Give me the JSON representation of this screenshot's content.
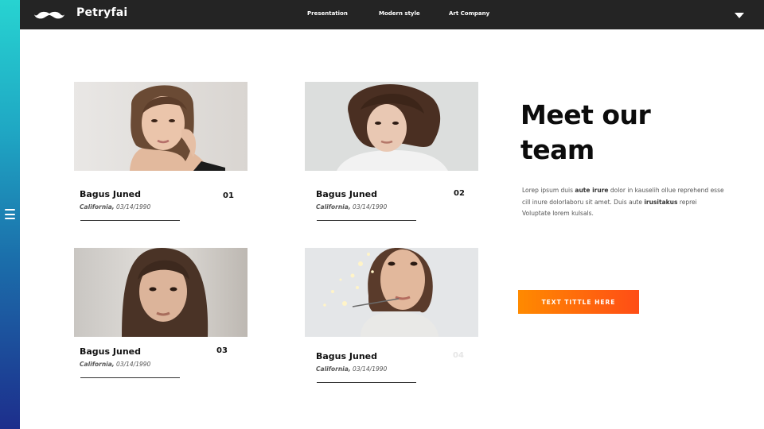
{
  "header": {
    "brand": "Petryfai",
    "logo_icon": "mustache-icon",
    "nav": [
      {
        "label": "Presentation"
      },
      {
        "label": "Modern style"
      },
      {
        "label": "Art Company"
      }
    ],
    "dropdown_icon": "caret-down-icon"
  },
  "sidebar": {
    "menu_icon": "hamburger-menu-icon",
    "gradient": [
      "#27d3d1",
      "#1d2e8c"
    ]
  },
  "team": {
    "cards": [
      {
        "name": "Bagus Juned",
        "location": "California,",
        "date": "03/14/1990",
        "number": "01"
      },
      {
        "name": "Bagus Juned",
        "location": "California,",
        "date": "03/14/1990",
        "number": "02"
      },
      {
        "name": "Bagus Juned",
        "location": "California,",
        "date": "03/14/1990",
        "number": "03"
      },
      {
        "name": "Bagus Juned",
        "location": "California,",
        "date": "03/14/1990",
        "number": "04"
      }
    ]
  },
  "intro": {
    "headline_line1": "Meet our",
    "headline_line2": "team",
    "paragraph": {
      "p1": "Lorep  ipsum duis ",
      "b1": "aute irure",
      "p2": " dolor in kauselih ollue reprehend esse cill inure dolorlaboru sit amet. Duis aute ",
      "b2": "irusitakus",
      "p3": " reprei Voluptate lorem kulsals."
    },
    "cta_label": "TEXT TITTLE HERE"
  },
  "colors": {
    "topbar": "#242424",
    "accent_start": "#ff8a00",
    "accent_end": "#ff4d16"
  }
}
